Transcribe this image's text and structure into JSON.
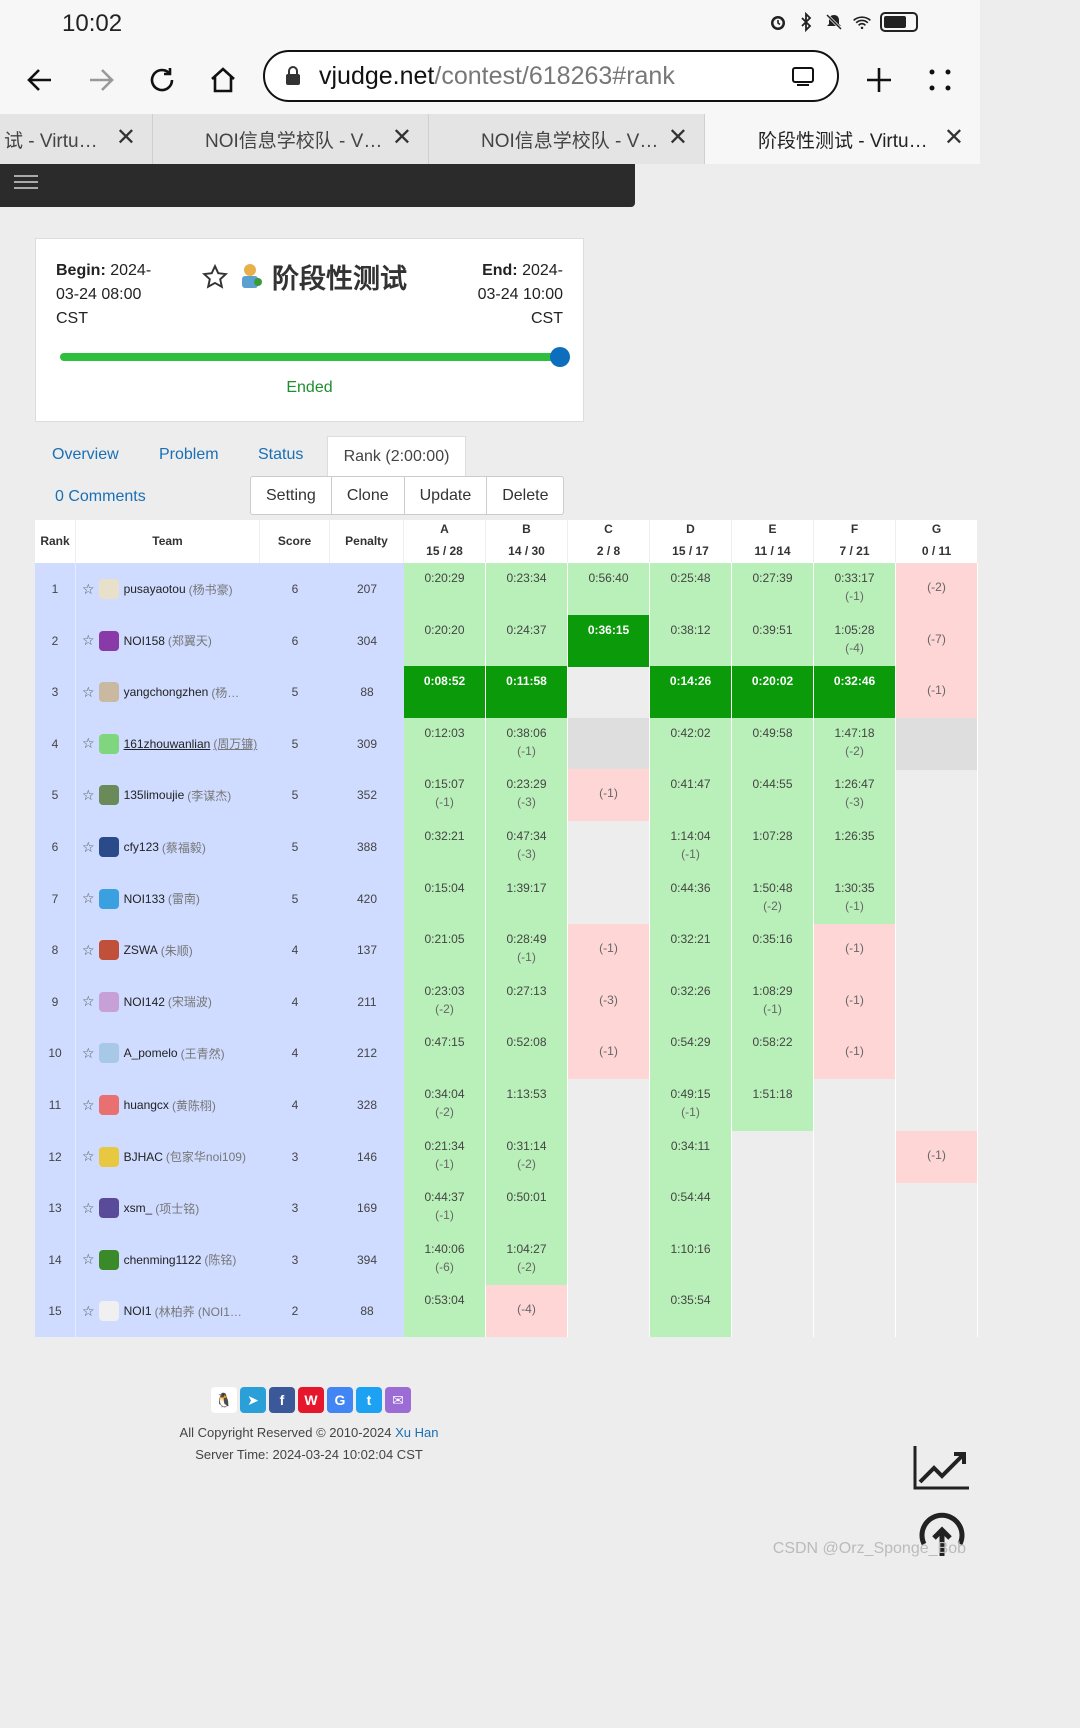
{
  "status_bar": {
    "time": "10:02"
  },
  "browser": {
    "url_domain": "vjudge.net",
    "url_path": "/contest/618263#rank",
    "tabs": [
      {
        "label": "试 - Virtu…",
        "active": false
      },
      {
        "label": "NOI信息学校队 - V…",
        "active": false
      },
      {
        "label": "NOI信息学校队 - V…",
        "active": false
      },
      {
        "label": "阶段性测试 - Virtu…",
        "active": true
      }
    ]
  },
  "contest": {
    "title": "阶段性测试",
    "begin_label": "Begin:",
    "begin_value": "2024-",
    "begin_line2": "03-24 08:00",
    "begin_line3": "CST",
    "end_label": "End:",
    "end_value": "2024-",
    "end_line2": "03-24 10:00",
    "end_line3": "CST",
    "status": "Ended",
    "progress": 1.0
  },
  "page_tabs": {
    "overview": "Overview",
    "problem": "Problem",
    "status": "Status",
    "rank": "Rank (2:00:00)",
    "comments": "0 Comments"
  },
  "actions": {
    "setting": "Setting",
    "clone": "Clone",
    "update": "Update",
    "delete": "Delete"
  },
  "rank_table": {
    "headers": {
      "rank": "Rank",
      "team": "Team",
      "score": "Score",
      "penalty": "Penalty"
    },
    "problems": [
      {
        "id": "A",
        "stat": "15 / 28"
      },
      {
        "id": "B",
        "stat": "14 / 30"
      },
      {
        "id": "C",
        "stat": "2 / 8"
      },
      {
        "id": "D",
        "stat": "15 / 17"
      },
      {
        "id": "E",
        "stat": "11 / 14"
      },
      {
        "id": "F",
        "stat": "7 / 21"
      },
      {
        "id": "G",
        "stat": "0 / 11"
      }
    ],
    "rows": [
      {
        "rank": "1",
        "user": "pusayaotou",
        "name": "(杨书豪)",
        "score": "6",
        "penalty": "207",
        "avatar": "#e8e0c8",
        "cells": [
          {
            "s": "ac",
            "t": "0:20:29"
          },
          {
            "s": "ac",
            "t": "0:23:34"
          },
          {
            "s": "ac",
            "t": "0:56:40"
          },
          {
            "s": "ac",
            "t": "0:25:48"
          },
          {
            "s": "ac",
            "t": "0:27:39"
          },
          {
            "s": "ac",
            "t": "0:33:17",
            "a": "(-1)"
          },
          {
            "s": "wa",
            "t": "(-2)"
          }
        ]
      },
      {
        "rank": "2",
        "user": "NOI158",
        "name": "(郑翼天)",
        "score": "6",
        "penalty": "304",
        "avatar": "#8a3aa8",
        "cells": [
          {
            "s": "ac",
            "t": "0:20:20"
          },
          {
            "s": "ac",
            "t": "0:24:37"
          },
          {
            "s": "fb",
            "t": "0:36:15"
          },
          {
            "s": "ac",
            "t": "0:38:12"
          },
          {
            "s": "ac",
            "t": "0:39:51"
          },
          {
            "s": "ac",
            "t": "1:05:28",
            "a": "(-4)"
          },
          {
            "s": "wa",
            "t": "(-7)"
          }
        ]
      },
      {
        "rank": "3",
        "user": "yangchongzhen",
        "name": "(杨…",
        "score": "5",
        "penalty": "88",
        "avatar": "#c9b9a0",
        "cells": [
          {
            "s": "fb",
            "t": "0:08:52"
          },
          {
            "s": "fb",
            "t": "0:11:58"
          },
          {
            "s": "none"
          },
          {
            "s": "fb",
            "t": "0:14:26"
          },
          {
            "s": "fb",
            "t": "0:20:02"
          },
          {
            "s": "fb",
            "t": "0:32:46"
          },
          {
            "s": "wa",
            "t": "(-1)"
          }
        ]
      },
      {
        "rank": "4",
        "user": "161zhouwanlian",
        "name": "(周万镰)",
        "score": "5",
        "penalty": "309",
        "avatar": "#7fd67f",
        "underline": true,
        "cells": [
          {
            "s": "ac",
            "t": "0:12:03"
          },
          {
            "s": "ac",
            "t": "0:38:06",
            "a": "(-1)"
          },
          {
            "s": "gray"
          },
          {
            "s": "ac",
            "t": "0:42:02"
          },
          {
            "s": "ac",
            "t": "0:49:58"
          },
          {
            "s": "ac",
            "t": "1:47:18",
            "a": "(-2)"
          },
          {
            "s": "gray"
          }
        ]
      },
      {
        "rank": "5",
        "user": "135limoujie",
        "name": "(李谋杰)",
        "score": "5",
        "penalty": "352",
        "avatar": "#6a8a5a",
        "cells": [
          {
            "s": "ac",
            "t": "0:15:07",
            "a": "(-1)"
          },
          {
            "s": "ac",
            "t": "0:23:29",
            "a": "(-3)"
          },
          {
            "s": "wa",
            "t": "(-1)"
          },
          {
            "s": "ac",
            "t": "0:41:47"
          },
          {
            "s": "ac",
            "t": "0:44:55"
          },
          {
            "s": "ac",
            "t": "1:26:47",
            "a": "(-3)"
          },
          {
            "s": "none"
          }
        ]
      },
      {
        "rank": "6",
        "user": "cfy123",
        "name": "(蔡福毅)",
        "score": "5",
        "penalty": "388",
        "avatar": "#2a4a8a",
        "cells": [
          {
            "s": "ac",
            "t": "0:32:21"
          },
          {
            "s": "ac",
            "t": "0:47:34",
            "a": "(-3)"
          },
          {
            "s": "none"
          },
          {
            "s": "ac",
            "t": "1:14:04",
            "a": "(-1)"
          },
          {
            "s": "ac",
            "t": "1:07:28"
          },
          {
            "s": "ac",
            "t": "1:26:35"
          },
          {
            "s": "none"
          }
        ]
      },
      {
        "rank": "7",
        "user": "NOI133",
        "name": "(雷南)",
        "score": "5",
        "penalty": "420",
        "avatar": "#3aa0e0",
        "cells": [
          {
            "s": "ac",
            "t": "0:15:04"
          },
          {
            "s": "ac",
            "t": "1:39:17"
          },
          {
            "s": "none"
          },
          {
            "s": "ac",
            "t": "0:44:36"
          },
          {
            "s": "ac",
            "t": "1:50:48",
            "a": "(-2)"
          },
          {
            "s": "ac",
            "t": "1:30:35",
            "a": "(-1)"
          },
          {
            "s": "none"
          }
        ]
      },
      {
        "rank": "8",
        "user": "ZSWA",
        "name": "(朱顺)",
        "score": "4",
        "penalty": "137",
        "avatar": "#c0503a",
        "cells": [
          {
            "s": "ac",
            "t": "0:21:05"
          },
          {
            "s": "ac",
            "t": "0:28:49",
            "a": "(-1)"
          },
          {
            "s": "wa",
            "t": "(-1)"
          },
          {
            "s": "ac",
            "t": "0:32:21"
          },
          {
            "s": "ac",
            "t": "0:35:16"
          },
          {
            "s": "wa",
            "t": "(-1)"
          },
          {
            "s": "none"
          }
        ]
      },
      {
        "rank": "9",
        "user": "NOI142",
        "name": "(宋瑞波)",
        "score": "4",
        "penalty": "211",
        "avatar": "#c8a0d8",
        "cells": [
          {
            "s": "ac",
            "t": "0:23:03",
            "a": "(-2)"
          },
          {
            "s": "ac",
            "t": "0:27:13"
          },
          {
            "s": "wa",
            "t": "(-3)"
          },
          {
            "s": "ac",
            "t": "0:32:26"
          },
          {
            "s": "ac",
            "t": "1:08:29",
            "a": "(-1)"
          },
          {
            "s": "wa",
            "t": "(-1)"
          },
          {
            "s": "none"
          }
        ]
      },
      {
        "rank": "10",
        "user": "A_pomelo",
        "name": "(王青然)",
        "score": "4",
        "penalty": "212",
        "avatar": "#a8c8e8",
        "cells": [
          {
            "s": "ac",
            "t": "0:47:15"
          },
          {
            "s": "ac",
            "t": "0:52:08"
          },
          {
            "s": "wa",
            "t": "(-1)"
          },
          {
            "s": "ac",
            "t": "0:54:29"
          },
          {
            "s": "ac",
            "t": "0:58:22"
          },
          {
            "s": "wa",
            "t": "(-1)"
          },
          {
            "s": "none"
          }
        ]
      },
      {
        "rank": "11",
        "user": "huangcx",
        "name": "(黄陈栩)",
        "score": "4",
        "penalty": "328",
        "avatar": "#e87070",
        "cells": [
          {
            "s": "ac",
            "t": "0:34:04",
            "a": "(-2)"
          },
          {
            "s": "ac",
            "t": "1:13:53"
          },
          {
            "s": "none"
          },
          {
            "s": "ac",
            "t": "0:49:15",
            "a": "(-1)"
          },
          {
            "s": "ac",
            "t": "1:51:18"
          },
          {
            "s": "none"
          },
          {
            "s": "none"
          }
        ]
      },
      {
        "rank": "12",
        "user": "BJHAC",
        "name": "(包家华noi109)",
        "score": "3",
        "penalty": "146",
        "avatar": "#e8c840",
        "cells": [
          {
            "s": "ac",
            "t": "0:21:34",
            "a": "(-1)"
          },
          {
            "s": "ac",
            "t": "0:31:14",
            "a": "(-2)"
          },
          {
            "s": "none"
          },
          {
            "s": "ac",
            "t": "0:34:11"
          },
          {
            "s": "none"
          },
          {
            "s": "none"
          },
          {
            "s": "wa",
            "t": "(-1)"
          }
        ]
      },
      {
        "rank": "13",
        "user": "xsm_",
        "name": "(项士铭)",
        "score": "3",
        "penalty": "169",
        "avatar": "#5a4a9a",
        "cells": [
          {
            "s": "ac",
            "t": "0:44:37",
            "a": "(-1)"
          },
          {
            "s": "ac",
            "t": "0:50:01"
          },
          {
            "s": "none"
          },
          {
            "s": "ac",
            "t": "0:54:44"
          },
          {
            "s": "none"
          },
          {
            "s": "none"
          },
          {
            "s": "none"
          }
        ]
      },
      {
        "rank": "14",
        "user": "chenming1122",
        "name": "(陈铭)",
        "score": "3",
        "penalty": "394",
        "avatar": "#3a8a2a",
        "cells": [
          {
            "s": "ac",
            "t": "1:40:06",
            "a": "(-6)"
          },
          {
            "s": "ac",
            "t": "1:04:27",
            "a": "(-2)"
          },
          {
            "s": "none"
          },
          {
            "s": "ac",
            "t": "1:10:16"
          },
          {
            "s": "none"
          },
          {
            "s": "none"
          },
          {
            "s": "none"
          }
        ]
      },
      {
        "rank": "15",
        "user": "NOI1",
        "name": "(林柏荞 (NOI1…",
        "score": "2",
        "penalty": "88",
        "avatar": "#f0f0f0",
        "cells": [
          {
            "s": "ac",
            "t": "0:53:04"
          },
          {
            "s": "wa",
            "t": "(-4)"
          },
          {
            "s": "none"
          },
          {
            "s": "ac",
            "t": "0:35:54"
          },
          {
            "s": "none"
          },
          {
            "s": "none"
          },
          {
            "s": "none"
          }
        ]
      }
    ]
  },
  "footer": {
    "copyright": "All Copyright Reserved © 2010-2024",
    "author": "Xu Han",
    "server_time": "Server Time: 2024-03-24 10:02:04 CST",
    "share_icons": [
      "qq-icon",
      "telegram-icon",
      "facebook-icon",
      "weibo-icon",
      "google-icon",
      "twitter-icon",
      "email-icon"
    ]
  },
  "watermark": "CSDN @Orz_Sponge_Bob",
  "colors": {
    "accepted": "#b9f0b9",
    "first_blood": "#0a9a0a",
    "wrong": "#ffd6d6",
    "row_info": "#cfdcff",
    "link": "#1a6fb5"
  }
}
